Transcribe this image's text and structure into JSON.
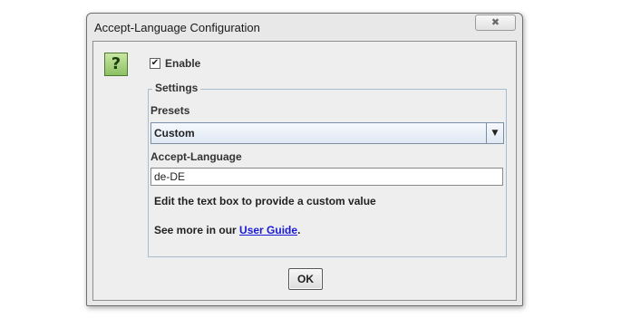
{
  "window": {
    "title": "Accept-Language Configuration",
    "close_icon": "close-icon",
    "close_glyph": "✖"
  },
  "help": {
    "icon": "question-mark-icon",
    "glyph": "?"
  },
  "enable": {
    "label": "Enable",
    "checked": true,
    "check_glyph": "✔"
  },
  "settings": {
    "legend": "Settings",
    "presets_label": "Presets",
    "presets_selected": "Custom",
    "dropdown_glyph": "▼",
    "accept_language_label": "Accept-Language",
    "accept_language_value": "de-DE",
    "hint": "Edit the text box to provide a custom value",
    "guide_prefix": "See more in our ",
    "guide_link": "User Guide",
    "guide_suffix": "."
  },
  "buttons": {
    "ok_label": "OK"
  },
  "colors": {
    "link": "#1a1ad6",
    "fieldset_border": "#a8bcd0",
    "help_icon_green": "#8cc063"
  }
}
